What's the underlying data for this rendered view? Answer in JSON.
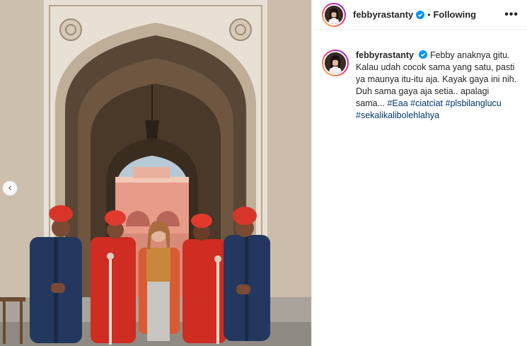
{
  "post": {
    "username": "febbyrastanty",
    "verified": true,
    "separator": "•",
    "follow_status": "Following",
    "more_glyph": "•••",
    "caption_text": "Febby anaknya gitu. Kalau udah cocok sama yang satu, pasti ya maunya itu-itu aja. Kayak gaya ini nih. Duh sama gaya aja setia.. apalagi sama...",
    "hashtags": [
      "#Eaa",
      "#ciatciat",
      "#plsbilanglucu",
      "#sekalikalibolehlahya"
    ]
  },
  "carousel": {
    "prev_glyph": "‹"
  },
  "icons": {
    "verified": "verified-badge-icon",
    "more": "more-options-icon",
    "prev": "chevron-left-icon"
  },
  "colors": {
    "accent_blue": "#0095f6",
    "hashtag": "#00376b",
    "guard_turban": "#d8352a",
    "guard_coat_blue": "#24375f"
  }
}
